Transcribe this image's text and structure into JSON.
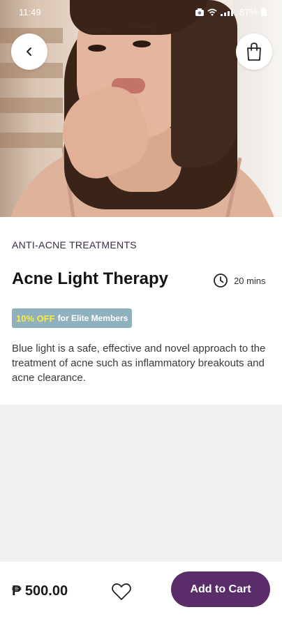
{
  "status_bar": {
    "time": "11:49",
    "battery": "87%",
    "icons": [
      "camera-icon",
      "wifi-icon",
      "signal-icon",
      "battery-icon"
    ]
  },
  "header": {
    "back_icon": "chevron-left-icon",
    "bag_icon": "shopping-bag-icon"
  },
  "product": {
    "category": "ANTI-ACNE TREATMENTS",
    "title": "Acne Light Therapy",
    "duration": "20 mins",
    "duration_icon": "clock-icon",
    "promo": {
      "discount": "10% OFF",
      "audience": "for Elite Members",
      "background": "#8fb1bd",
      "discount_color": "#ffea3f"
    },
    "description": "Blue light is a safe, effective and novel approach to the treatment of acne such as inflammatory breakouts and acne clearance."
  },
  "footer": {
    "price": "₱ 500.00",
    "favorite_icon": "heart-outline-icon",
    "add_to_cart_label": "Add to Cart",
    "button_color": "#5a2c6a"
  }
}
